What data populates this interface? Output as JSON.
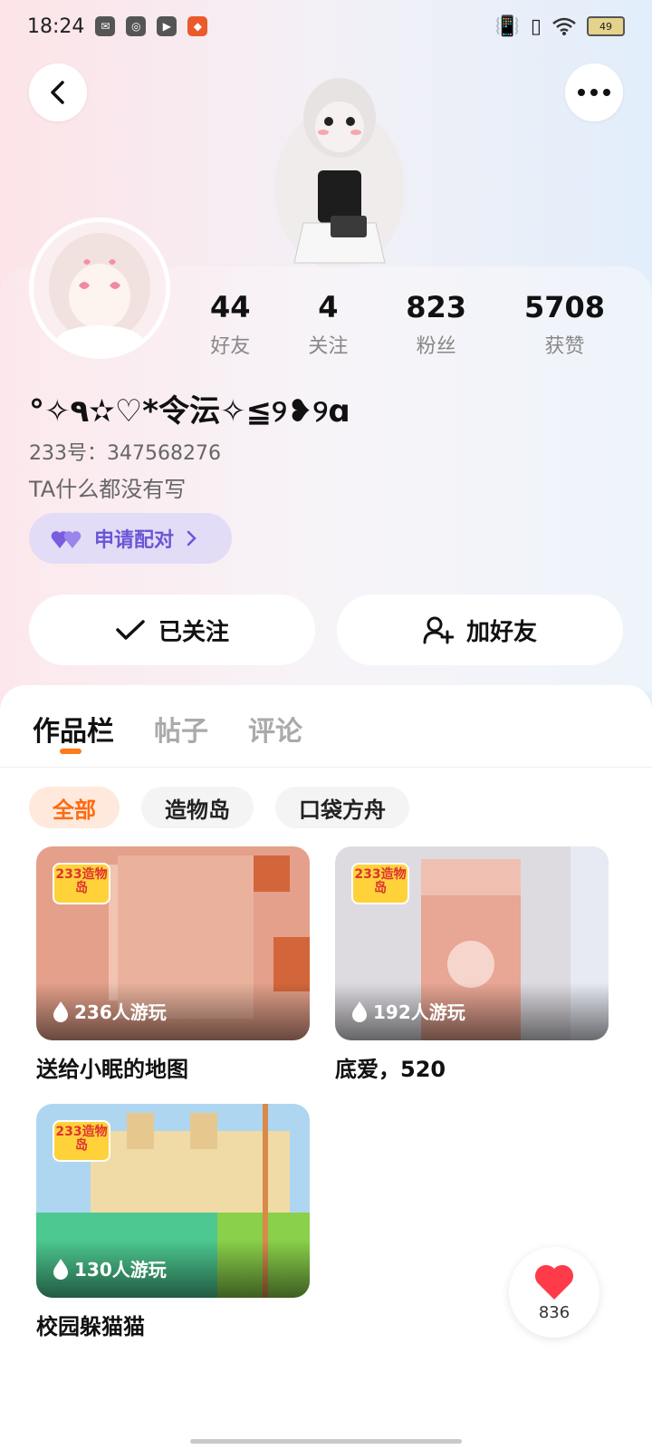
{
  "status_bar": {
    "time": "18:24",
    "battery": "49"
  },
  "profile": {
    "nickname": "°✧٩✫♡*令沄✧≦୨❥୨ɑ",
    "user_id": "233号：347568276",
    "bio": "TA什么都没有写",
    "pair_button": "申请配对"
  },
  "stats": [
    {
      "value": "44",
      "label": "好友"
    },
    {
      "value": "4",
      "label": "关注"
    },
    {
      "value": "823",
      "label": "粉丝"
    },
    {
      "value": "5708",
      "label": "获赞"
    }
  ],
  "actions": {
    "follow": "已关注",
    "add_friend": "加好友"
  },
  "tabs": [
    "作品栏",
    "帖子",
    "评论"
  ],
  "chips": [
    "全部",
    "造物岛",
    "口袋方舟"
  ],
  "logo_text": "233造物岛",
  "works": [
    {
      "title": "送给小眠的地图",
      "plays": "236人游玩",
      "color_a": "#d98c78",
      "color_b": "#f2b69c"
    },
    {
      "title": "底爱，520",
      "plays": "192人游玩",
      "color_a": "#dcd9de",
      "color_b": "#e59a86"
    },
    {
      "title": "校园躲猫猫",
      "plays": "130人游玩",
      "color_a": "#a9d3f0",
      "color_b": "#3fbf7a"
    }
  ],
  "like_count": "836",
  "colors": {
    "accent": "#ff7a1a",
    "pair_purple": "#6b56d6",
    "like_red": "#ff3b4a"
  }
}
